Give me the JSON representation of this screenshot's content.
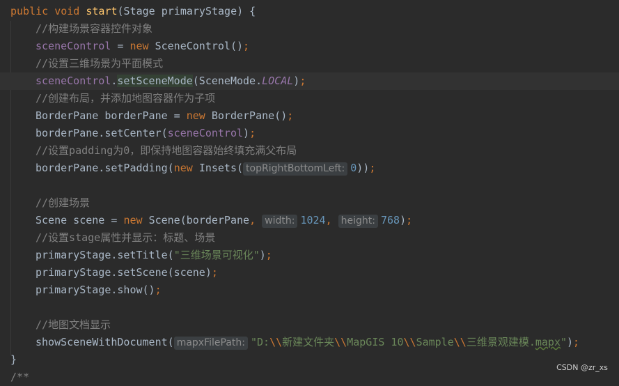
{
  "lines": [
    {
      "tokens": [
        {
          "t": "public ",
          "c": "kw"
        },
        {
          "t": "void ",
          "c": "kw"
        },
        {
          "t": "start",
          "c": "fn"
        },
        {
          "t": "(Stage primaryStage) {",
          "c": ""
        }
      ]
    },
    {
      "indent": 1,
      "tokens": [
        {
          "t": "//构建场景容器控件对象",
          "c": "cmt"
        }
      ]
    },
    {
      "indent": 1,
      "tokens": [
        {
          "t": "sceneControl",
          "c": "fld"
        },
        {
          "t": " = ",
          "c": ""
        },
        {
          "t": "new ",
          "c": "kw"
        },
        {
          "t": "SceneControl()",
          "c": ""
        },
        {
          "t": ";",
          "c": "kw"
        }
      ]
    },
    {
      "indent": 1,
      "tokens": [
        {
          "t": "//设置三维场景为平面模式",
          "c": "cmt"
        }
      ]
    },
    {
      "indent": 1,
      "current": true,
      "tokens": [
        {
          "t": "sceneControl",
          "c": "fld"
        },
        {
          "t": ".",
          "c": ""
        },
        {
          "t": "setSceneMode",
          "c": "sel"
        },
        {
          "t": "(SceneMode.",
          "c": ""
        },
        {
          "t": "LOCAL",
          "c": "ital"
        },
        {
          "t": ")",
          "c": ""
        },
        {
          "t": ";",
          "c": "kw"
        }
      ]
    },
    {
      "indent": 1,
      "tokens": [
        {
          "t": "//创建布局，并添加地图容器作为子项",
          "c": "cmt"
        }
      ]
    },
    {
      "indent": 1,
      "tokens": [
        {
          "t": "BorderPane borderPane = ",
          "c": ""
        },
        {
          "t": "new ",
          "c": "kw"
        },
        {
          "t": "BorderPane()",
          "c": ""
        },
        {
          "t": ";",
          "c": "kw"
        }
      ]
    },
    {
      "indent": 1,
      "tokens": [
        {
          "t": "borderPane.setCenter(",
          "c": ""
        },
        {
          "t": "sceneControl",
          "c": "fld"
        },
        {
          "t": ")",
          "c": ""
        },
        {
          "t": ";",
          "c": "kw"
        }
      ]
    },
    {
      "indent": 1,
      "tokens": [
        {
          "t": "//设置padding为0，即保持地图容器始终填充满父布局",
          "c": "cmt"
        }
      ]
    },
    {
      "indent": 1,
      "tokens": [
        {
          "t": "borderPane.setPadding(",
          "c": ""
        },
        {
          "t": "new ",
          "c": "kw"
        },
        {
          "t": "Insets(",
          "c": ""
        },
        {
          "t": "topRightBottomLeft:",
          "c": "hint"
        },
        {
          "t": "0",
          "c": "num"
        },
        {
          "t": "))",
          "c": ""
        },
        {
          "t": ";",
          "c": "kw"
        }
      ]
    },
    {
      "indent": 1,
      "tokens": []
    },
    {
      "indent": 1,
      "tokens": [
        {
          "t": "//创建场景",
          "c": "cmt"
        }
      ]
    },
    {
      "indent": 1,
      "tokens": [
        {
          "t": "Scene scene = ",
          "c": ""
        },
        {
          "t": "new ",
          "c": "kw"
        },
        {
          "t": "Scene(borderPane",
          "c": ""
        },
        {
          "t": ", ",
          "c": "kw"
        },
        {
          "t": "width:",
          "c": "hint"
        },
        {
          "t": "1024",
          "c": "num"
        },
        {
          "t": ", ",
          "c": "kw"
        },
        {
          "t": "height:",
          "c": "hint"
        },
        {
          "t": "768",
          "c": "num"
        },
        {
          "t": ")",
          "c": ""
        },
        {
          "t": ";",
          "c": "kw"
        }
      ]
    },
    {
      "indent": 1,
      "tokens": [
        {
          "t": "//设置stage属性并显示：标题、场景",
          "c": "cmt"
        }
      ]
    },
    {
      "indent": 1,
      "tokens": [
        {
          "t": "primaryStage.setTitle(",
          "c": ""
        },
        {
          "t": "\"三维场景可视化\"",
          "c": "str"
        },
        {
          "t": ")",
          "c": ""
        },
        {
          "t": ";",
          "c": "kw"
        }
      ]
    },
    {
      "indent": 1,
      "tokens": [
        {
          "t": "primaryStage.setScene(scene)",
          "c": ""
        },
        {
          "t": ";",
          "c": "kw"
        }
      ]
    },
    {
      "indent": 1,
      "tokens": [
        {
          "t": "primaryStage.show()",
          "c": ""
        },
        {
          "t": ";",
          "c": "kw"
        }
      ]
    },
    {
      "indent": 1,
      "tokens": []
    },
    {
      "indent": 1,
      "tokens": [
        {
          "t": "//地图文档显示",
          "c": "cmt"
        }
      ]
    },
    {
      "indent": 1,
      "tokens": [
        {
          "t": "showSceneWithDocument(",
          "c": ""
        },
        {
          "t": "mapxFilePath:",
          "c": "hint"
        },
        {
          "t": "\"D:",
          "c": "str"
        },
        {
          "t": "\\\\",
          "c": "kw"
        },
        {
          "t": "新建文件夹",
          "c": "str"
        },
        {
          "t": "\\\\",
          "c": "kw"
        },
        {
          "t": "MapGIS 10",
          "c": "str"
        },
        {
          "t": "\\\\",
          "c": "kw"
        },
        {
          "t": "Sample",
          "c": "str"
        },
        {
          "t": "\\\\",
          "c": "kw"
        },
        {
          "t": "三维景观建模.",
          "c": "str"
        },
        {
          "t": "mapx",
          "c": "sq"
        },
        {
          "t": "\"",
          "c": "str"
        },
        {
          "t": ")",
          "c": ""
        },
        {
          "t": ";",
          "c": "kw"
        }
      ]
    },
    {
      "tokens": [
        {
          "t": "}",
          "c": ""
        }
      ]
    },
    {
      "tokens": [
        {
          "t": "/**",
          "c": "cmt"
        }
      ]
    }
  ],
  "watermark": "CSDN @zr_xs"
}
